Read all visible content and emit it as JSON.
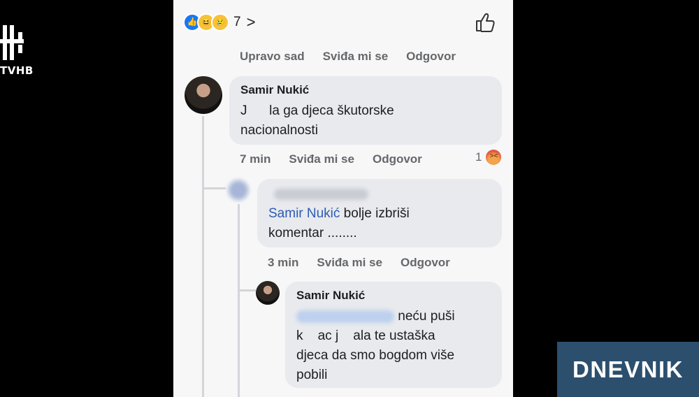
{
  "channel": {
    "logo_text": "TVHB",
    "logo_icon": "tvhb-logo-icon"
  },
  "reactions_bar": {
    "icons": [
      "like-reaction-icon",
      "haha-reaction-icon",
      "sad-reaction-icon"
    ],
    "count": "7",
    "chevron": ">"
  },
  "top_actions": {
    "time": "Upravo sad",
    "like": "Sviđa mi se",
    "reply": "Odgovor"
  },
  "comments": [
    {
      "author": "Samir Nukić",
      "text": "J▒▒▒▒▒la ga djeca škutorske nacionalnosti",
      "text_line1": "J      la ga djeca škutorske",
      "text_line2": "nacionalnosti",
      "time": "7 min",
      "like": "Sviđa mi se",
      "reply": "Odgovor",
      "reaction_count": "1",
      "reaction_icon": "angry-reaction-icon"
    },
    {
      "author": "",
      "author_redacted": true,
      "mention": "Samir Nukić",
      "text_line1_rest": " bolje izbriši",
      "text_line2": "komentar ........",
      "time": "3 min",
      "like": "Sviđa mi se",
      "reply": "Odgovor"
    },
    {
      "author": "Samir Nukić",
      "mention_redacted": true,
      "text_line1_rest": "neću puši",
      "text_line2": "k    ac j    ala te ustaška",
      "text_line3": "djeca da smo bogdom više",
      "text_line4": "pobili"
    }
  ],
  "overlay": {
    "label": "DNEVNIK",
    "color": "#2c4f6e"
  }
}
